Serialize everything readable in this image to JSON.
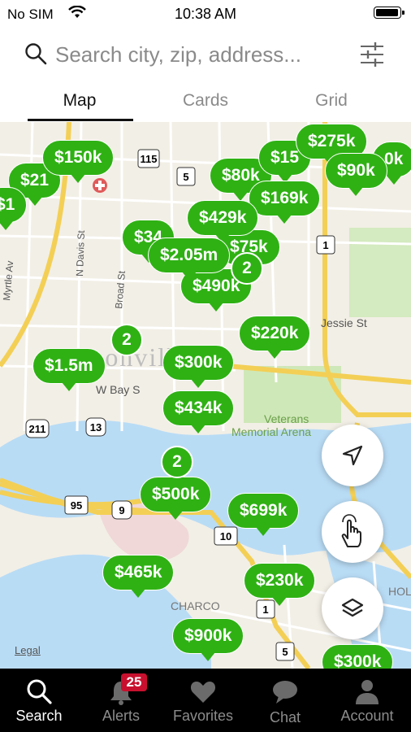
{
  "status_bar": {
    "carrier": "No SIM",
    "time": "10:38 AM"
  },
  "search": {
    "placeholder": "Search city, zip, address..."
  },
  "tabs": [
    {
      "label": "Map"
    },
    {
      "label": "Cards"
    },
    {
      "label": "Grid"
    }
  ],
  "map": {
    "pins": [
      {
        "label": "$150k"
      },
      {
        "label": "$21"
      },
      {
        "label": "$1"
      },
      {
        "label": "$80k"
      },
      {
        "label": "$15"
      },
      {
        "label": "$275k"
      },
      {
        "label": "$90k"
      },
      {
        "label": "0k"
      },
      {
        "label": "$169k"
      },
      {
        "label": "$429k"
      },
      {
        "label": "$34"
      },
      {
        "label": "$75k"
      },
      {
        "label": "$2.05m"
      },
      {
        "label": "$490k"
      },
      {
        "label": "$220k"
      },
      {
        "label": "$1.5m"
      },
      {
        "label": "$300k"
      },
      {
        "label": "$434k"
      },
      {
        "label": "$500k"
      },
      {
        "label": "$699k"
      },
      {
        "label": "$465k"
      },
      {
        "label": "$230k"
      },
      {
        "label": "$900k"
      },
      {
        "label": "$300k"
      }
    ],
    "clusters": [
      {
        "label": "2"
      },
      {
        "label": "2"
      },
      {
        "label": "2"
      }
    ],
    "road_labels": {
      "jessie": "Jessie St",
      "bay": "W Bay S",
      "veterans": "Veterans",
      "arena": "Memorial Arena",
      "davis": "N Davis St",
      "broad": "Broad St",
      "myrtle": "Myrtle Av",
      "jacksonville": "Jacksonville",
      "charco": "CHARCO",
      "hol": "HOL"
    },
    "shields": [
      "115",
      "5",
      "1",
      "211",
      "13",
      "95",
      "9",
      "10",
      "1",
      "5"
    ],
    "legal": "Legal"
  },
  "tab_bar": {
    "items": [
      {
        "label": "Search"
      },
      {
        "label": "Alerts"
      },
      {
        "label": "Favorites"
      },
      {
        "label": "Chat"
      },
      {
        "label": "Account"
      }
    ],
    "alerts_badge": "25"
  },
  "colors": {
    "pin_green": "#2fb114",
    "badge_red": "#c8102e"
  }
}
